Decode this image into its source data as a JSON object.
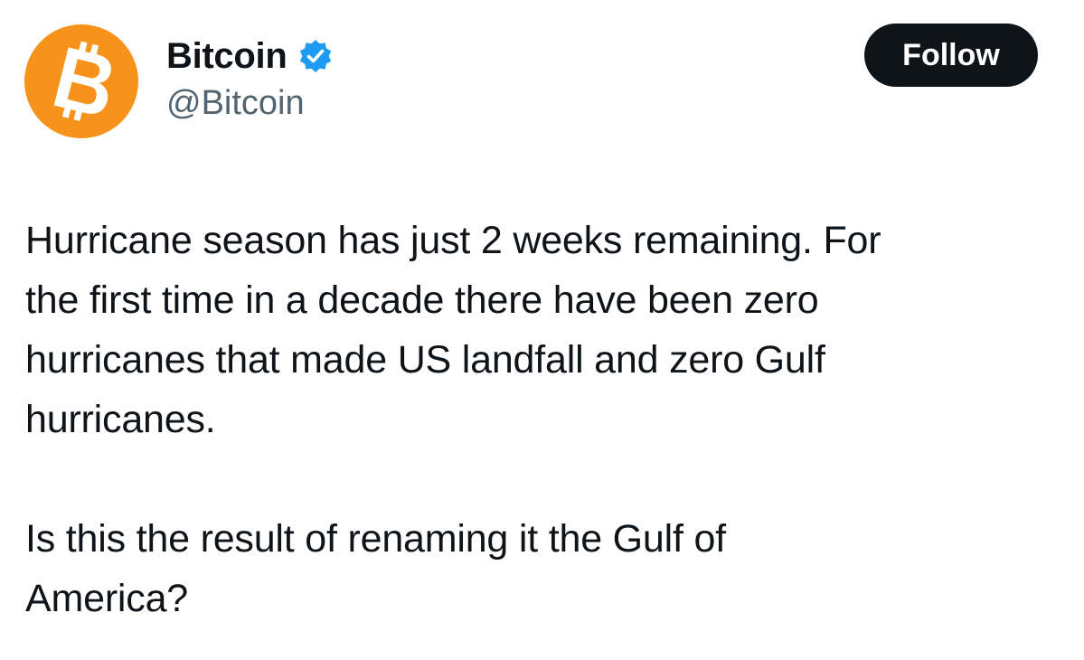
{
  "author": {
    "display_name": "Bitcoin",
    "handle": "@Bitcoin",
    "avatar_icon": "bitcoin-logo-icon",
    "verified_icon": "verified-badge-icon",
    "avatar_color": "#f7931a",
    "verified_color": "#1d9bf0"
  },
  "actions": {
    "follow_label": "Follow"
  },
  "tweet": {
    "text": "Hurricane season has just 2 weeks remaining. For\nthe first time in a decade there have been zero\nhurricanes that made US landfall and zero Gulf\nhurricanes.\n\nIs this the result of renaming it the Gulf of\nAmerica?"
  }
}
